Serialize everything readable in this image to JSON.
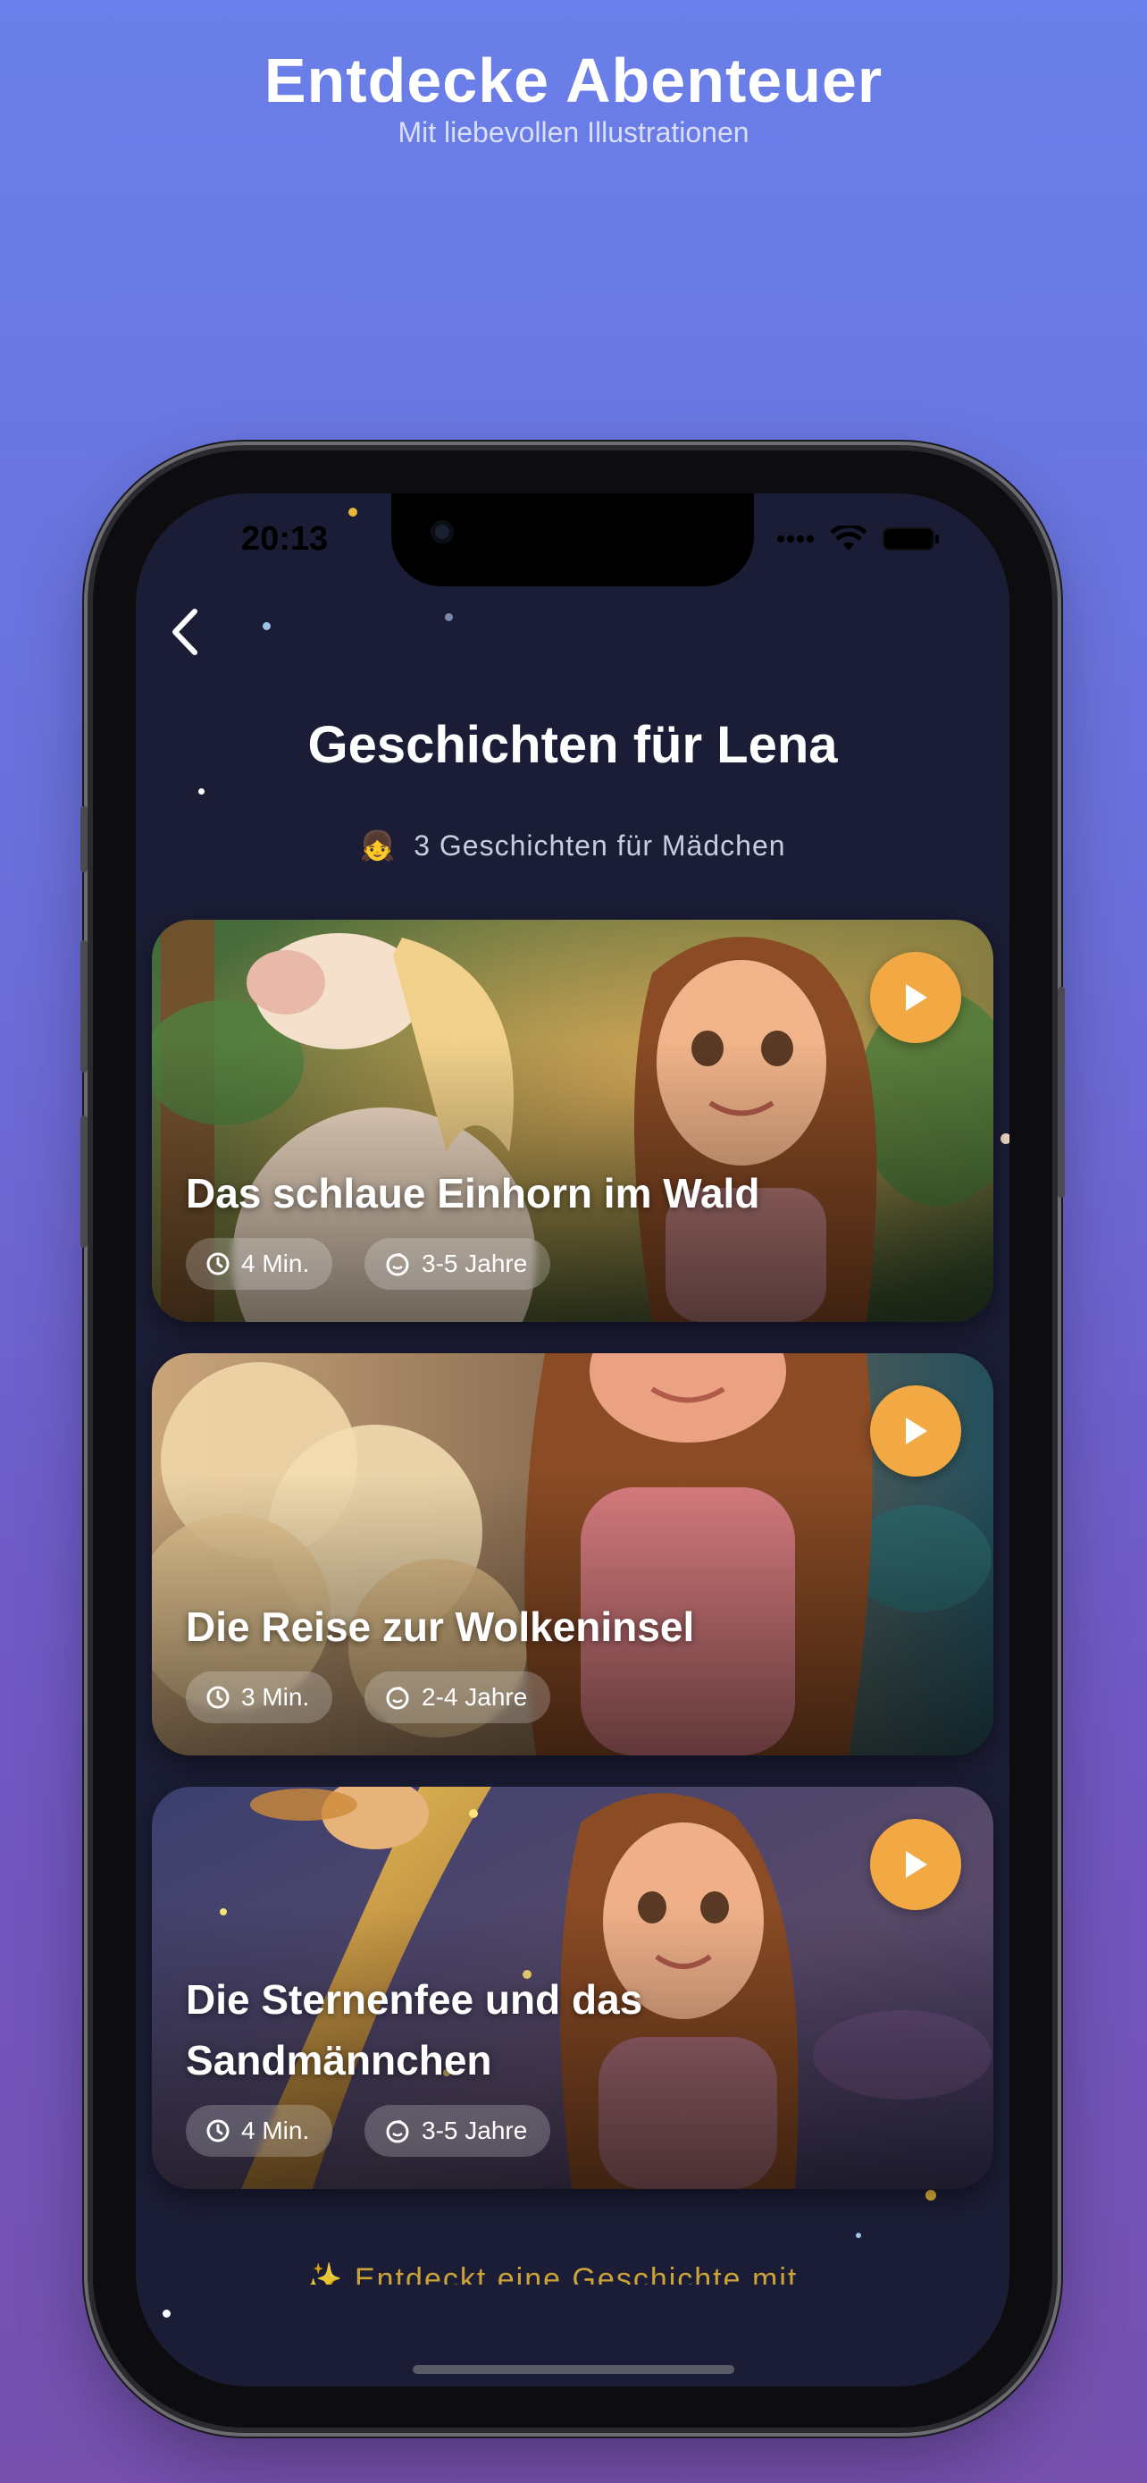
{
  "promo": {
    "title": "Entdecke Abenteuer",
    "subtitle": "Mit liebevollen Illustrationen"
  },
  "status_bar": {
    "time": "20:13",
    "icons": [
      "signal-icon",
      "wifi-icon",
      "battery-icon"
    ]
  },
  "header": {
    "back_icon": "chevron-left-icon",
    "title": "Geschichten für Lena",
    "subtitle_emoji": "👧",
    "subtitle": "3 Geschichten für Mädchen"
  },
  "stories": [
    {
      "title": "Das schlaue Einhorn im Wald",
      "duration": "4 Min.",
      "age": "3-5 Jahre"
    },
    {
      "title": "Die Reise zur Wolkeninsel",
      "duration": "3 Min.",
      "age": "2-4 Jahre"
    },
    {
      "title": "Die Sternenfee und das Sandmännchen",
      "duration": "4 Min.",
      "age": "3-5 Jahre"
    }
  ],
  "footer": {
    "teaser": "✨ Entdeckt eine Geschichte mit …"
  },
  "colors": {
    "accent": "#f2a944",
    "screen_bg": "#1b1d36",
    "background_top": "#6a7fe9",
    "background_bottom": "#7550ad"
  }
}
